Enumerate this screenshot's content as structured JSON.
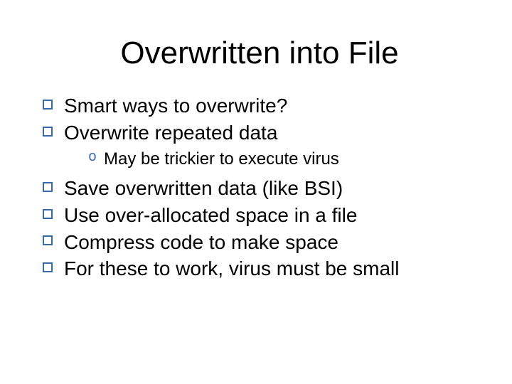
{
  "slide": {
    "title": "Overwritten into File",
    "bullets": [
      {
        "text": "Smart ways to overwrite?"
      },
      {
        "text": "Overwrite repeated data",
        "children": [
          {
            "text": "May be trickier to execute virus"
          }
        ]
      },
      {
        "text": "Save overwritten data (like BSI)"
      },
      {
        "text": "Use over-allocated space in a file"
      },
      {
        "text": "Compress code to make space"
      },
      {
        "text": "For these to work, virus must be small"
      }
    ]
  }
}
